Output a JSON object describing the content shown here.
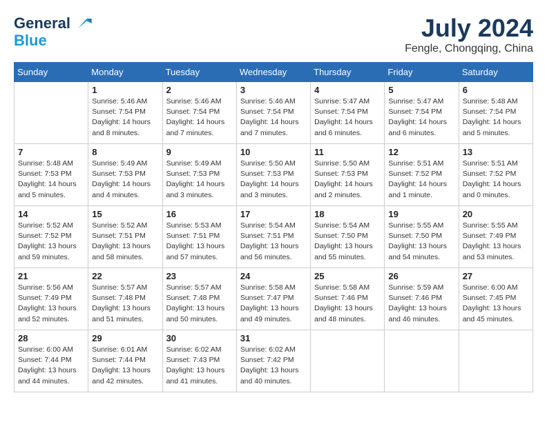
{
  "header": {
    "logo_line1": "General",
    "logo_line2": "Blue",
    "month_year": "July 2024",
    "location": "Fengle, Chongqing, China"
  },
  "weekdays": [
    "Sunday",
    "Monday",
    "Tuesday",
    "Wednesday",
    "Thursday",
    "Friday",
    "Saturday"
  ],
  "weeks": [
    [
      {
        "day": "",
        "detail": ""
      },
      {
        "day": "1",
        "detail": "Sunrise: 5:46 AM\nSunset: 7:54 PM\nDaylight: 14 hours\nand 8 minutes."
      },
      {
        "day": "2",
        "detail": "Sunrise: 5:46 AM\nSunset: 7:54 PM\nDaylight: 14 hours\nand 7 minutes."
      },
      {
        "day": "3",
        "detail": "Sunrise: 5:46 AM\nSunset: 7:54 PM\nDaylight: 14 hours\nand 7 minutes."
      },
      {
        "day": "4",
        "detail": "Sunrise: 5:47 AM\nSunset: 7:54 PM\nDaylight: 14 hours\nand 6 minutes."
      },
      {
        "day": "5",
        "detail": "Sunrise: 5:47 AM\nSunset: 7:54 PM\nDaylight: 14 hours\nand 6 minutes."
      },
      {
        "day": "6",
        "detail": "Sunrise: 5:48 AM\nSunset: 7:54 PM\nDaylight: 14 hours\nand 5 minutes."
      }
    ],
    [
      {
        "day": "7",
        "detail": "Sunrise: 5:48 AM\nSunset: 7:53 PM\nDaylight: 14 hours\nand 5 minutes."
      },
      {
        "day": "8",
        "detail": "Sunrise: 5:49 AM\nSunset: 7:53 PM\nDaylight: 14 hours\nand 4 minutes."
      },
      {
        "day": "9",
        "detail": "Sunrise: 5:49 AM\nSunset: 7:53 PM\nDaylight: 14 hours\nand 3 minutes."
      },
      {
        "day": "10",
        "detail": "Sunrise: 5:50 AM\nSunset: 7:53 PM\nDaylight: 14 hours\nand 3 minutes."
      },
      {
        "day": "11",
        "detail": "Sunrise: 5:50 AM\nSunset: 7:53 PM\nDaylight: 14 hours\nand 2 minutes."
      },
      {
        "day": "12",
        "detail": "Sunrise: 5:51 AM\nSunset: 7:52 PM\nDaylight: 14 hours\nand 1 minute."
      },
      {
        "day": "13",
        "detail": "Sunrise: 5:51 AM\nSunset: 7:52 PM\nDaylight: 14 hours\nand 0 minutes."
      }
    ],
    [
      {
        "day": "14",
        "detail": "Sunrise: 5:52 AM\nSunset: 7:52 PM\nDaylight: 13 hours\nand 59 minutes."
      },
      {
        "day": "15",
        "detail": "Sunrise: 5:52 AM\nSunset: 7:51 PM\nDaylight: 13 hours\nand 58 minutes."
      },
      {
        "day": "16",
        "detail": "Sunrise: 5:53 AM\nSunset: 7:51 PM\nDaylight: 13 hours\nand 57 minutes."
      },
      {
        "day": "17",
        "detail": "Sunrise: 5:54 AM\nSunset: 7:51 PM\nDaylight: 13 hours\nand 56 minutes."
      },
      {
        "day": "18",
        "detail": "Sunrise: 5:54 AM\nSunset: 7:50 PM\nDaylight: 13 hours\nand 55 minutes."
      },
      {
        "day": "19",
        "detail": "Sunrise: 5:55 AM\nSunset: 7:50 PM\nDaylight: 13 hours\nand 54 minutes."
      },
      {
        "day": "20",
        "detail": "Sunrise: 5:55 AM\nSunset: 7:49 PM\nDaylight: 13 hours\nand 53 minutes."
      }
    ],
    [
      {
        "day": "21",
        "detail": "Sunrise: 5:56 AM\nSunset: 7:49 PM\nDaylight: 13 hours\nand 52 minutes."
      },
      {
        "day": "22",
        "detail": "Sunrise: 5:57 AM\nSunset: 7:48 PM\nDaylight: 13 hours\nand 51 minutes."
      },
      {
        "day": "23",
        "detail": "Sunrise: 5:57 AM\nSunset: 7:48 PM\nDaylight: 13 hours\nand 50 minutes."
      },
      {
        "day": "24",
        "detail": "Sunrise: 5:58 AM\nSunset: 7:47 PM\nDaylight: 13 hours\nand 49 minutes."
      },
      {
        "day": "25",
        "detail": "Sunrise: 5:58 AM\nSunset: 7:46 PM\nDaylight: 13 hours\nand 48 minutes."
      },
      {
        "day": "26",
        "detail": "Sunrise: 5:59 AM\nSunset: 7:46 PM\nDaylight: 13 hours\nand 46 minutes."
      },
      {
        "day": "27",
        "detail": "Sunrise: 6:00 AM\nSunset: 7:45 PM\nDaylight: 13 hours\nand 45 minutes."
      }
    ],
    [
      {
        "day": "28",
        "detail": "Sunrise: 6:00 AM\nSunset: 7:44 PM\nDaylight: 13 hours\nand 44 minutes."
      },
      {
        "day": "29",
        "detail": "Sunrise: 6:01 AM\nSunset: 7:44 PM\nDaylight: 13 hours\nand 42 minutes."
      },
      {
        "day": "30",
        "detail": "Sunrise: 6:02 AM\nSunset: 7:43 PM\nDaylight: 13 hours\nand 41 minutes."
      },
      {
        "day": "31",
        "detail": "Sunrise: 6:02 AM\nSunset: 7:42 PM\nDaylight: 13 hours\nand 40 minutes."
      },
      {
        "day": "",
        "detail": ""
      },
      {
        "day": "",
        "detail": ""
      },
      {
        "day": "",
        "detail": ""
      }
    ]
  ]
}
